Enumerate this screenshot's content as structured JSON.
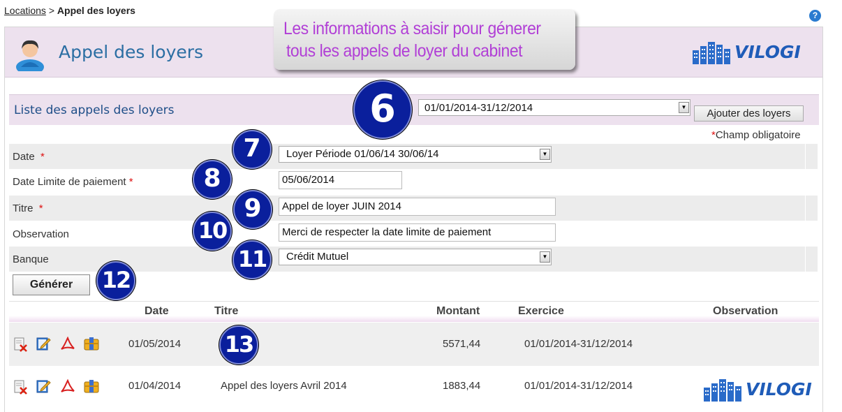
{
  "breadcrumb": {
    "link": "Locations",
    "separator": ">",
    "current": "Appel des loyers"
  },
  "help": {
    "label": "?"
  },
  "header": {
    "title": "Appel des loyers",
    "logo_text": "VILOGI"
  },
  "callout": {
    "line1": "Les informations à saisir pour génerer",
    "line2": "tous les appels de loyer du cabinet"
  },
  "section": {
    "title": "Liste des appels des loyers",
    "period_selected": "01/01/2014-31/12/2014",
    "add_button": "Ajouter des loyers",
    "required_mark": "*",
    "required_note": "Champ obligatoire"
  },
  "form": {
    "date_label": "Date",
    "date_value": "Loyer Période 01/06/14 30/06/14",
    "due_label": "Date Limite de paiement",
    "due_value": "05/06/2014",
    "title_label": "Titre",
    "title_value": "Appel de loyer JUIN 2014",
    "observation_label": "Observation",
    "observation_value": "Merci de respecter la date limite de paiement",
    "bank_label": "Banque",
    "bank_value": "Crédit Mutuel",
    "required_mark": "*",
    "generate_button": "Générer"
  },
  "badges": {
    "b6": "6",
    "b7": "7",
    "b8": "8",
    "b9": "9",
    "b10": "10",
    "b11": "11",
    "b12": "12",
    "b13": "13"
  },
  "table": {
    "columns": [
      "Date",
      "Titre",
      "Montant",
      "Exercice",
      "Observation"
    ],
    "rows": [
      {
        "date": "01/05/2014",
        "title": "",
        "amount": "5571,44",
        "period": "01/01/2014-31/12/2014",
        "observation": ""
      },
      {
        "date": "01/04/2014",
        "title": "Appel des loyers Avril 2014",
        "amount": "1883,44",
        "period": "01/01/2014-31/12/2014",
        "observation": ""
      }
    ],
    "row_icons": [
      "delete-doc-icon",
      "edit-icon",
      "pdf-icon",
      "archive-icon"
    ]
  },
  "colors": {
    "accent_purple": "#b13fd6",
    "title_blue": "#2b6ea3",
    "badge_blue": "#0a1f9c",
    "header_band": "#ede1ee"
  }
}
